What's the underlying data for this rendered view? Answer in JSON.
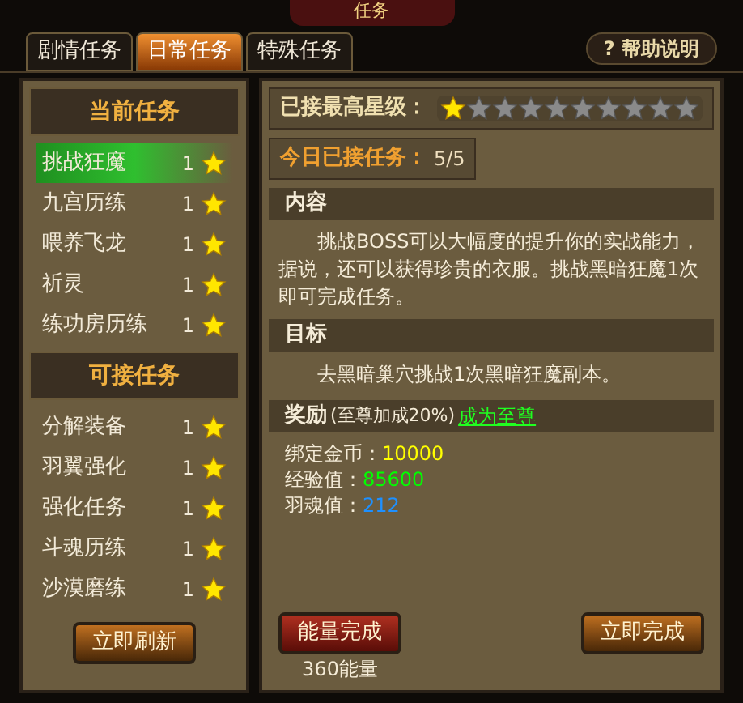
{
  "window": {
    "title": "任务",
    "help_button": "? 帮助说明"
  },
  "tabs": [
    {
      "label": "剧情任务",
      "selected": false
    },
    {
      "label": "日常任务",
      "selected": true
    },
    {
      "label": "特殊任务",
      "selected": false
    }
  ],
  "current_tasks": {
    "heading": "当前任务",
    "items": [
      {
        "name": "挑战狂魔",
        "level": "1",
        "selected": true
      },
      {
        "name": "九宫历练",
        "level": "1",
        "selected": false
      },
      {
        "name": "喂养飞龙",
        "level": "1",
        "selected": false
      },
      {
        "name": "祈灵",
        "level": "1",
        "selected": false
      },
      {
        "name": "练功房历练",
        "level": "1",
        "selected": false
      }
    ]
  },
  "available_tasks": {
    "heading": "可接任务",
    "items": [
      {
        "name": "分解装备",
        "level": "1",
        "selected": false
      },
      {
        "name": "羽翼强化",
        "level": "1",
        "selected": false
      },
      {
        "name": "强化任务",
        "level": "1",
        "selected": false
      },
      {
        "name": "斗魂历练",
        "level": "1",
        "selected": false
      },
      {
        "name": "沙漠磨练",
        "level": "1",
        "selected": false
      }
    ],
    "refresh_button": "立即刷新"
  },
  "max_star_level": {
    "label": "已接最高星级：",
    "stars": 1
  },
  "today_accepted": {
    "label": "今日已接任务：",
    "value": "5/5"
  },
  "content": {
    "heading": "内容",
    "text": "挑战BOSS可以大幅度的提升你的实战能力，据说，还可以获得珍贵的衣服。挑战黑暗狂魔1次即可完成任务。"
  },
  "goal": {
    "heading": "目标",
    "text": "去黑暗巢穴挑战1次黑暗狂魔副本。"
  },
  "reward": {
    "heading": "奖励",
    "bonus": "(至尊加成20%)",
    "link": "成为至尊",
    "items": [
      {
        "label": "绑定金币：",
        "value": "10000",
        "color": "#ffff00"
      },
      {
        "label": "经验值：",
        "value": "85600",
        "color": "#00ff00"
      },
      {
        "label": "羽魂值：",
        "value": "212",
        "color": "#1e90ff"
      }
    ]
  },
  "energy_button": "能量完成",
  "energy_cost": "360能量",
  "complete_button": "立即完成"
}
